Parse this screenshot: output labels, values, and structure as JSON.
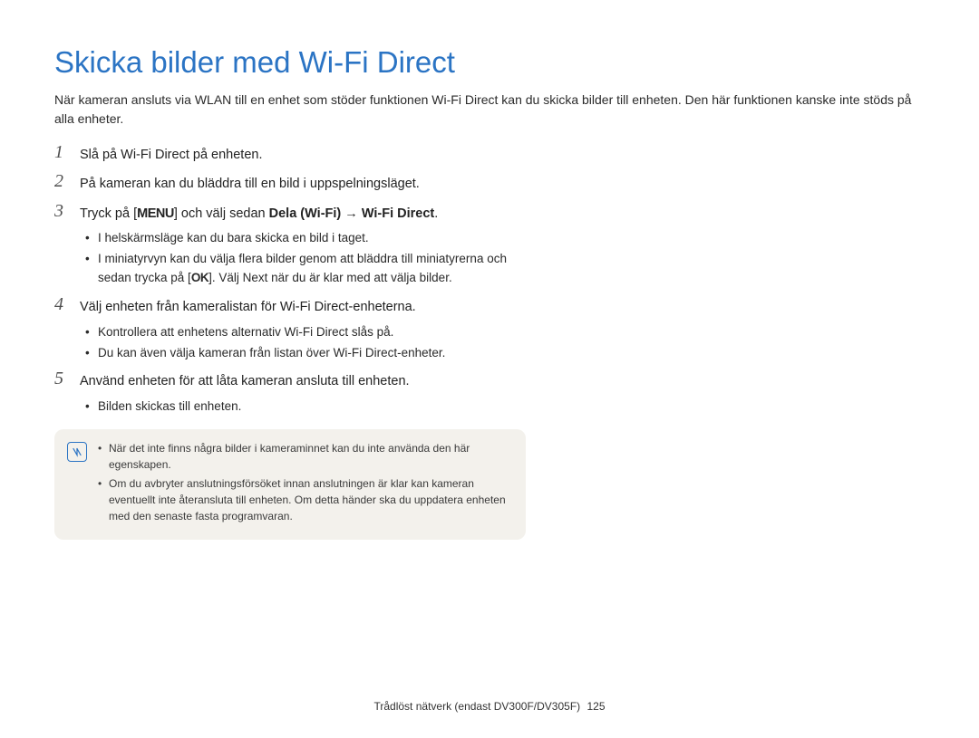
{
  "title": "Skicka bilder med Wi-Fi Direct",
  "intro": "När kameran ansluts via WLAN till en enhet som stöder funktionen Wi-Fi Direct kan du skicka bilder till enheten. Den här funktionen kanske inte stöds på alla enheter.",
  "steps": {
    "s1": {
      "num": "1",
      "text": "Slå på Wi-Fi Direct på enheten."
    },
    "s2": {
      "num": "2",
      "text": "På kameran kan du bläddra till en bild i uppspelningsläget."
    },
    "s3": {
      "num": "3",
      "pre": "Tryck på [",
      "menu": "MENU",
      "mid": "] och välj sedan ",
      "bold1": "Dela (Wi-Fi)",
      "arrow": " → ",
      "bold2": "Wi-Fi Direct",
      "post": ".",
      "bullets": [
        "I helskärmsläge kan du bara skicka en bild i taget.",
        "I miniatyrvyn kan du välja flera bilder genom att bläddra till miniatyrerna och sedan trycka på [OK]. Välj Next när du är klar med att välja bilder."
      ],
      "b2_pre": "I miniatyrvyn kan du välja flera bilder genom att bläddra till miniatyrerna och sedan trycka på [",
      "b2_ok": "OK",
      "b2_mid": "]. Välj ",
      "b2_next": "Next",
      "b2_post": " när du är klar med att välja bilder."
    },
    "s4": {
      "num": "4",
      "text": "Välj enheten från kameralistan för Wi-Fi Direct-enheterna.",
      "bullets": [
        "Kontrollera att enhetens alternativ Wi-Fi Direct slås på.",
        "Du kan även välja kameran från listan över Wi-Fi Direct-enheter."
      ]
    },
    "s5": {
      "num": "5",
      "text": "Använd enheten för att låta kameran ansluta till enheten.",
      "bullets": [
        "Bilden skickas till enheten."
      ]
    }
  },
  "notes": [
    "När det inte finns några bilder i kameraminnet kan du inte använda den här egenskapen.",
    "Om du avbryter anslutningsförsöket innan anslutningen är klar kan kameran eventuellt inte återansluta till enheten. Om detta händer ska du uppdatera enheten med den senaste fasta programvaran."
  ],
  "footer": {
    "text": "Trådlöst nätverk (endast DV300F/DV305F)",
    "page": "125"
  }
}
